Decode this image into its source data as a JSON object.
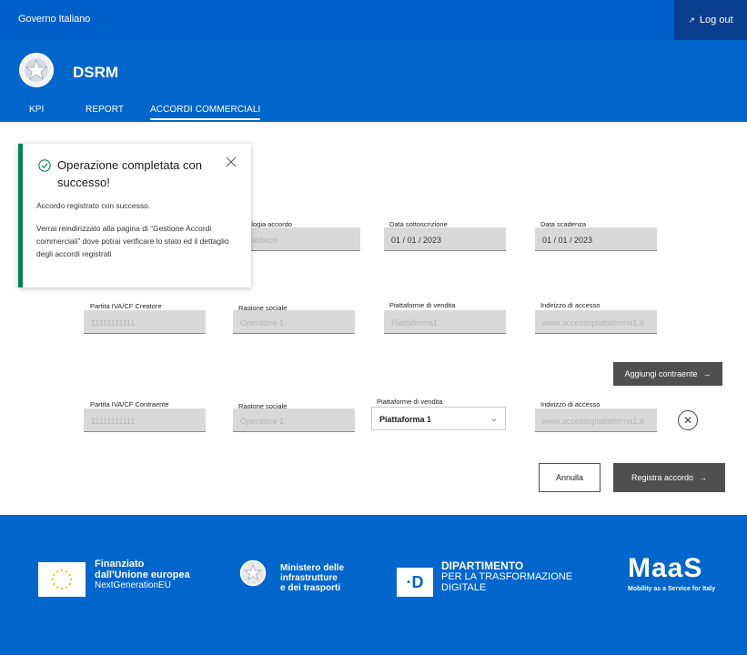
{
  "topbar": {
    "gov_label": "Governo Italiano",
    "logout_label": "Log out",
    "logout_icon": "arrow-icon"
  },
  "header": {
    "brand": "DSRM",
    "tabs": [
      {
        "label": "KPI"
      },
      {
        "label": "REPORT"
      },
      {
        "label": "ACCORDI COMMERCIALI",
        "active": true
      }
    ]
  },
  "toast": {
    "title": "Operazione completata con successo!",
    "message1": "Accordo registrato con successo.",
    "message2": "Verrai reindirizzato alla pagina di “Gestione Accordi commerciali” dove potrai verificare lo stato ed il dettaglio degli accordi registrati",
    "status_color": "#008055"
  },
  "agreement": {
    "tipologia_label": "Tipologia accordo",
    "tipologia_value": "Pubblico",
    "data_sottoscrizione_label": "Data sottoscrizione",
    "data_sottoscrizione_value": "01 / 01 / 2023",
    "data_scadenza_label": "Data scadenza",
    "data_scadenza_value": "01 / 01 / 2023"
  },
  "creator": {
    "piva_label": "Partita IVA/CF Creatore",
    "piva_value": "11111111111",
    "ragione_label": "Ragione sociale",
    "ragione_value": "Operatore 1",
    "piattaforme_label": "Piattaforme di vendita",
    "piattaforme_value": "Piattaforma1",
    "indirizzo_label": "Indirizzo  di accesso",
    "indirizzo_value": "www.accessopiattaforma1.it"
  },
  "add_contractor_label": "Aggiungi contraente",
  "contractor": {
    "piva_label": "Partita IVA/CF Contraente",
    "piva_value": "11111111111",
    "ragione_label": "Ragione sociale",
    "ragione_value": "Operatore 1",
    "piattaforme_label": "Piattaforme di vendita",
    "piattaforme_value": "Piattaforma 1",
    "indirizzo_label": "Indirizzo  di accesso",
    "indirizzo_value": "www.accessopiattaforma1.it"
  },
  "actions": {
    "cancel_label": "Annulla",
    "submit_label": "Registra accordo"
  },
  "footer": {
    "eu_line1": "Finanziato",
    "eu_line2": "dall'Unione europea",
    "eu_line3": "NextGenerationEU",
    "mit_line1": "Ministero delle",
    "mit_line2": "infrastrutture",
    "mit_line3": "e dei trasporti",
    "dtd_mark": "·D",
    "dtd_line1": "DIPARTIMENTO",
    "dtd_line2": "PER LA TRASFORMAZIONE",
    "dtd_line3": "DIGITALE",
    "maas_logo": "MaaS",
    "maas_tagline": "Mobility as a Service for Italy"
  },
  "colors": {
    "primary": "#0066cc",
    "topbar": "#0060c9",
    "button_dark": "#4f4f4f",
    "success": "#008055"
  }
}
